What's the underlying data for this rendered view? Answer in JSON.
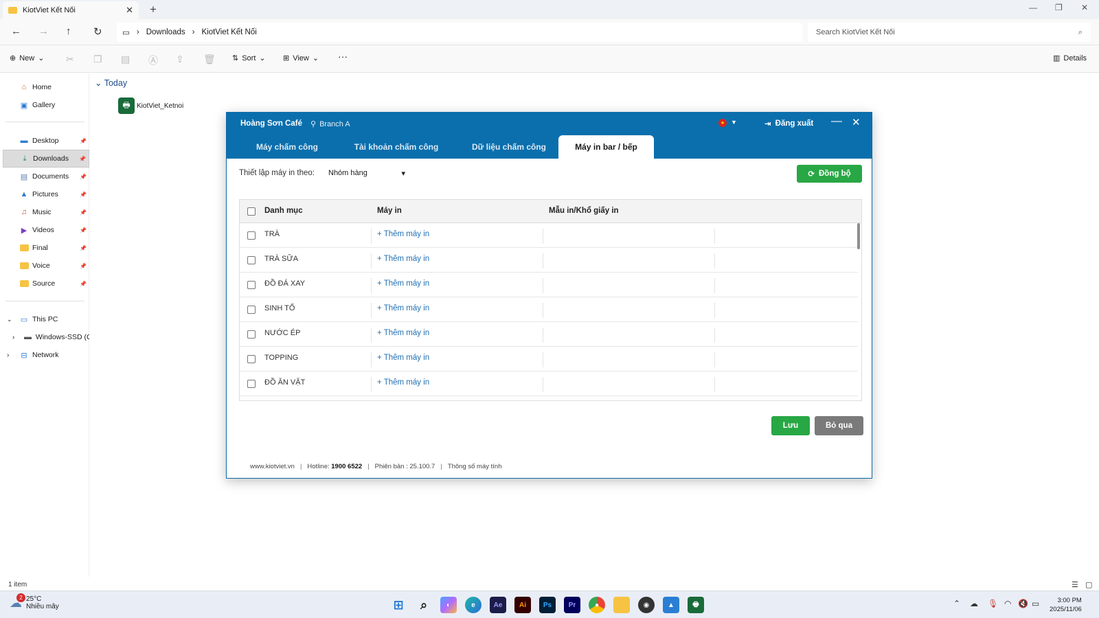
{
  "window": {
    "tab_title": "KiotViet Kết Nối",
    "breadcrumb": [
      "Downloads",
      "KiotViet Kết Nối"
    ],
    "search_placeholder": "Search KiotViet Kết Nối"
  },
  "toolbar": {
    "new_label": "New",
    "sort_label": "Sort",
    "view_label": "View",
    "more_label": "···",
    "details_label": "Details"
  },
  "sidebar": {
    "top": [
      {
        "label": "Home",
        "icon": "home-icon"
      },
      {
        "label": "Gallery",
        "icon": "gallery-icon"
      }
    ],
    "quick": [
      {
        "label": "Desktop",
        "icon": "desktop-icon"
      },
      {
        "label": "Downloads",
        "icon": "downloads-icon",
        "selected": true
      },
      {
        "label": "Documents",
        "icon": "documents-icon"
      },
      {
        "label": "Pictures",
        "icon": "pictures-icon"
      },
      {
        "label": "Music",
        "icon": "music-icon"
      },
      {
        "label": "Videos",
        "icon": "videos-icon"
      },
      {
        "label": "Final",
        "icon": "folder-icon"
      },
      {
        "label": "Voice",
        "icon": "folder-icon"
      },
      {
        "label": "Source",
        "icon": "folder-icon"
      }
    ],
    "this_pc": "This PC",
    "drive": "Windows-SSD (C:",
    "network": "Network"
  },
  "content": {
    "group": "Today",
    "file_name": "KiotViet_Ketnoi"
  },
  "status": {
    "count": "1 item"
  },
  "taskbar": {
    "weather_temp": "25°C",
    "weather_desc": "Nhiều mây",
    "weather_badge": "2",
    "time": "3:00 PM",
    "date": "2025/11/06"
  },
  "kiotviet": {
    "shop_name": "Hoàng Sơn Café",
    "branch": "Branch A",
    "logout": "Đăng xuất",
    "tabs": [
      "Máy chấm công",
      "Tài khoản chấm công",
      "Dữ liệu chấm công",
      "Máy in bar / bếp"
    ],
    "active_tab": 3,
    "setting_label": "Thiết lập máy in theo:",
    "setting_value": "Nhóm hàng",
    "sync_label": "Đồng bộ",
    "columns": [
      "Danh mục",
      "Máy in",
      "Mẫu in/Khổ giấy in"
    ],
    "add_printer": "+ Thêm máy in",
    "rows": [
      "TRÀ",
      "TRÀ SỮA",
      "ĐỒ ĐÁ XAY",
      "SINH TỐ",
      "NƯỚC ÉP",
      "TOPPING",
      "ĐỒ ĂN VẶT"
    ],
    "save_label": "Lưu",
    "skip_label": "Bỏ qua",
    "footer": {
      "site": "www.kiotviet.vn",
      "hotline_label": "Hotline:",
      "hotline": "1900 6522",
      "version": "Phiên bản : 25.100.7",
      "specs": "Thông số máy tính"
    }
  }
}
